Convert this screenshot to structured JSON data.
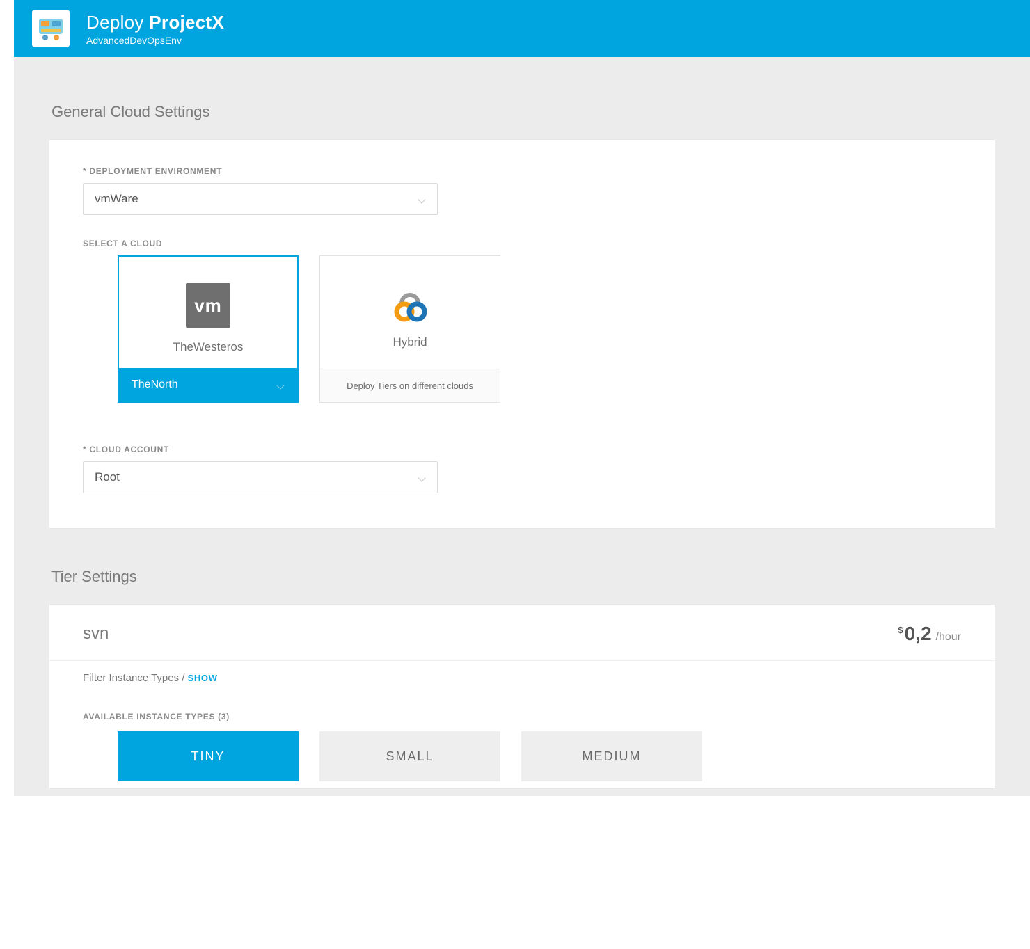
{
  "header": {
    "title_prefix": "Deploy",
    "title_strong": "ProjectX",
    "subtitle": "AdvancedDevOpsEnv"
  },
  "sections": {
    "general_title": "General Cloud Settings",
    "tier_title": "Tier Settings"
  },
  "general": {
    "deploy_env_label": "* DEPLOYMENT ENVIRONMENT",
    "deploy_env_value": "vmWare",
    "select_cloud_label": "SELECT A CLOUD",
    "cloud_account_label": "* CLOUD ACCOUNT",
    "cloud_account_value": "Root",
    "clouds": {
      "westeros": {
        "label": "TheWesteros",
        "region": "TheNorth",
        "vm_text": "vm"
      },
      "hybrid": {
        "label": "Hybrid",
        "footer": "Deploy Tiers on different clouds"
      }
    }
  },
  "tier": {
    "name": "svn",
    "currency": "$",
    "price": "0,2",
    "unit": "/hour",
    "filter_label": "Filter Instance Types /",
    "show_label": "SHOW",
    "available_label": "AVAILABLE INSTANCE TYPES (3)",
    "instances": {
      "tiny": "TINY",
      "small": "SMALL",
      "medium": "MEDIUM"
    }
  }
}
